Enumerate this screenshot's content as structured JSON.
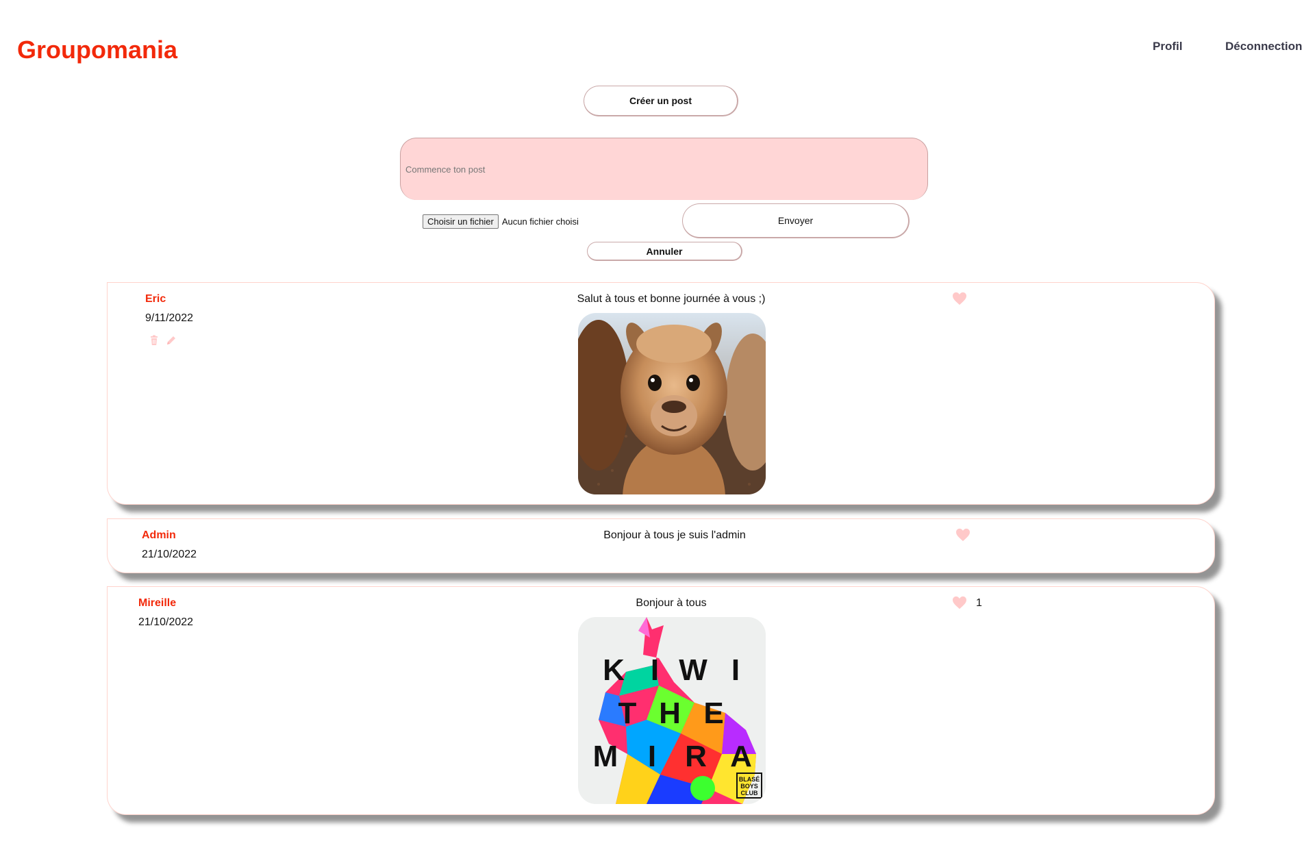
{
  "header": {
    "logo": "Groupomania",
    "nav_profil": "Profil",
    "nav_logout": "Déconnection"
  },
  "composer": {
    "create_label": "Créer un post",
    "placeholder": "Commence ton post",
    "file_button": "Choisir un fichier",
    "file_status": "Aucun fichier choisi",
    "send_label": "Envoyer",
    "cancel_label": "Annuler"
  },
  "posts": [
    {
      "author": "Eric",
      "date": "9/11/2022",
      "text": "Salut à tous et bonne journée à vous ;)",
      "likes": "",
      "image": "alpaca-photo"
    },
    {
      "author": "Admin",
      "date": "21/10/2022",
      "text": "Bonjour à tous je suis l'admin",
      "likes": ""
    },
    {
      "author": "Mireille",
      "date": "21/10/2022",
      "text": "Bonjour à tous",
      "likes": "1",
      "image": "kiwi-the-mira-cover",
      "image_text": [
        "K",
        "I",
        "W",
        "I",
        "T",
        "H",
        "E",
        "M",
        "I",
        "R",
        "A",
        "BLASÉ",
        "BOYS",
        "CLUB"
      ]
    }
  ],
  "colors": {
    "brand": "#f2290a",
    "input_bg": "#ffd6d6",
    "heart": "#ffc9c9",
    "card_border": "#ffd3cc"
  },
  "icons": {
    "delete": "trash-icon",
    "edit": "pencil-icon",
    "like": "heart-icon"
  }
}
